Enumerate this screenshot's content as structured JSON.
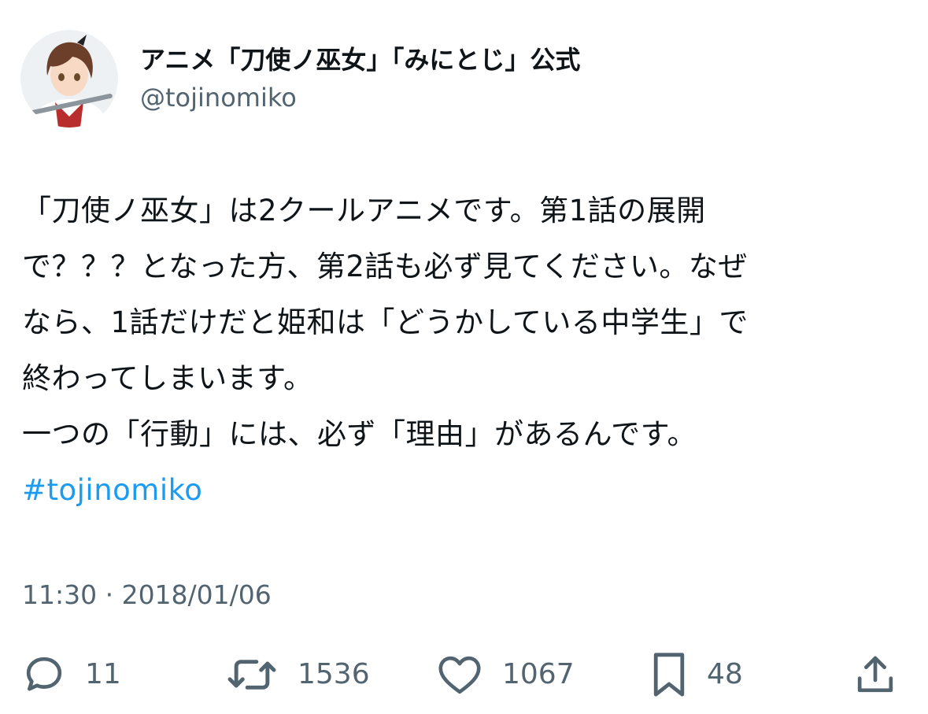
{
  "author": {
    "display_name": "アニメ「刀使ノ巫女」「みにとじ」公式",
    "handle": "@tojinomiko"
  },
  "tweet": {
    "lines": [
      "「刀使ノ巫女」は2クールアニメです。第1話の展開",
      "で？？？となった方、第2話も必ず見てください。なぜ",
      "なら、1話だけだと姫和は「どうかしている中学生」で",
      "終わってしまいます。",
      "一つの「行動」には、必ず「理由」があるんです。"
    ],
    "hashtag": "#tojinomiko",
    "timestamp": "11:30 · 2018/01/06"
  },
  "actions": {
    "reply": {
      "icon": "reply-icon",
      "count": "11"
    },
    "retweet": {
      "icon": "retweet-icon",
      "count": "1536"
    },
    "like": {
      "icon": "heart-icon",
      "count": "1067"
    },
    "bookmark": {
      "icon": "bookmark-icon",
      "count": "48"
    },
    "share": {
      "icon": "share-icon"
    }
  },
  "colors": {
    "text": "#0f1419",
    "secondary": "#536471",
    "link": "#1d9bf0"
  }
}
